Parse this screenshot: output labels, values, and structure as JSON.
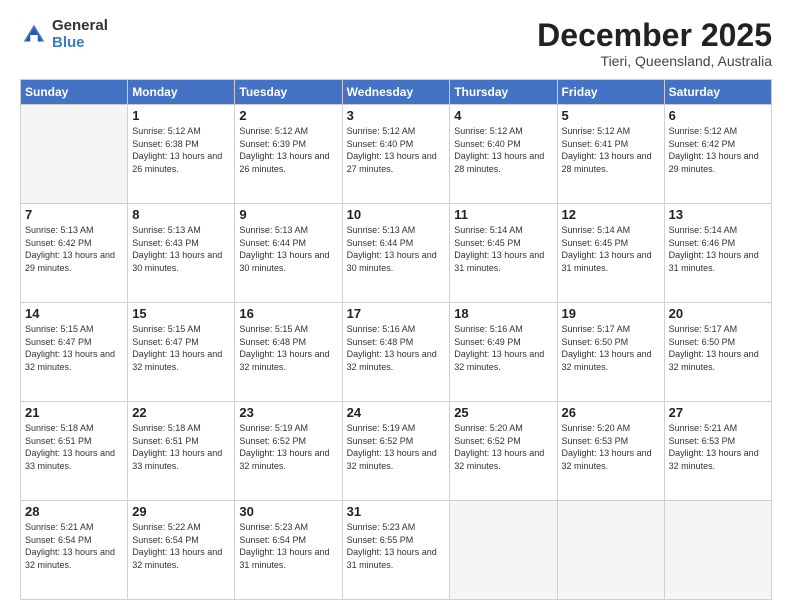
{
  "logo": {
    "general": "General",
    "blue": "Blue"
  },
  "header": {
    "month": "December 2025",
    "location": "Tieri, Queensland, Australia"
  },
  "weekdays": [
    "Sunday",
    "Monday",
    "Tuesday",
    "Wednesday",
    "Thursday",
    "Friday",
    "Saturday"
  ],
  "weeks": [
    [
      {
        "day": "",
        "empty": true
      },
      {
        "day": "1",
        "sunrise": "5:12 AM",
        "sunset": "6:38 PM",
        "daylight": "13 hours and 26 minutes."
      },
      {
        "day": "2",
        "sunrise": "5:12 AM",
        "sunset": "6:39 PM",
        "daylight": "13 hours and 26 minutes."
      },
      {
        "day": "3",
        "sunrise": "5:12 AM",
        "sunset": "6:40 PM",
        "daylight": "13 hours and 27 minutes."
      },
      {
        "day": "4",
        "sunrise": "5:12 AM",
        "sunset": "6:40 PM",
        "daylight": "13 hours and 28 minutes."
      },
      {
        "day": "5",
        "sunrise": "5:12 AM",
        "sunset": "6:41 PM",
        "daylight": "13 hours and 28 minutes."
      },
      {
        "day": "6",
        "sunrise": "5:12 AM",
        "sunset": "6:42 PM",
        "daylight": "13 hours and 29 minutes."
      }
    ],
    [
      {
        "day": "7",
        "sunrise": "5:13 AM",
        "sunset": "6:42 PM",
        "daylight": "13 hours and 29 minutes."
      },
      {
        "day": "8",
        "sunrise": "5:13 AM",
        "sunset": "6:43 PM",
        "daylight": "13 hours and 30 minutes."
      },
      {
        "day": "9",
        "sunrise": "5:13 AM",
        "sunset": "6:44 PM",
        "daylight": "13 hours and 30 minutes."
      },
      {
        "day": "10",
        "sunrise": "5:13 AM",
        "sunset": "6:44 PM",
        "daylight": "13 hours and 30 minutes."
      },
      {
        "day": "11",
        "sunrise": "5:14 AM",
        "sunset": "6:45 PM",
        "daylight": "13 hours and 31 minutes."
      },
      {
        "day": "12",
        "sunrise": "5:14 AM",
        "sunset": "6:45 PM",
        "daylight": "13 hours and 31 minutes."
      },
      {
        "day": "13",
        "sunrise": "5:14 AM",
        "sunset": "6:46 PM",
        "daylight": "13 hours and 31 minutes."
      }
    ],
    [
      {
        "day": "14",
        "sunrise": "5:15 AM",
        "sunset": "6:47 PM",
        "daylight": "13 hours and 32 minutes."
      },
      {
        "day": "15",
        "sunrise": "5:15 AM",
        "sunset": "6:47 PM",
        "daylight": "13 hours and 32 minutes."
      },
      {
        "day": "16",
        "sunrise": "5:15 AM",
        "sunset": "6:48 PM",
        "daylight": "13 hours and 32 minutes."
      },
      {
        "day": "17",
        "sunrise": "5:16 AM",
        "sunset": "6:48 PM",
        "daylight": "13 hours and 32 minutes."
      },
      {
        "day": "18",
        "sunrise": "5:16 AM",
        "sunset": "6:49 PM",
        "daylight": "13 hours and 32 minutes."
      },
      {
        "day": "19",
        "sunrise": "5:17 AM",
        "sunset": "6:50 PM",
        "daylight": "13 hours and 32 minutes."
      },
      {
        "day": "20",
        "sunrise": "5:17 AM",
        "sunset": "6:50 PM",
        "daylight": "13 hours and 32 minutes."
      }
    ],
    [
      {
        "day": "21",
        "sunrise": "5:18 AM",
        "sunset": "6:51 PM",
        "daylight": "13 hours and 33 minutes."
      },
      {
        "day": "22",
        "sunrise": "5:18 AM",
        "sunset": "6:51 PM",
        "daylight": "13 hours and 33 minutes."
      },
      {
        "day": "23",
        "sunrise": "5:19 AM",
        "sunset": "6:52 PM",
        "daylight": "13 hours and 32 minutes."
      },
      {
        "day": "24",
        "sunrise": "5:19 AM",
        "sunset": "6:52 PM",
        "daylight": "13 hours and 32 minutes."
      },
      {
        "day": "25",
        "sunrise": "5:20 AM",
        "sunset": "6:52 PM",
        "daylight": "13 hours and 32 minutes."
      },
      {
        "day": "26",
        "sunrise": "5:20 AM",
        "sunset": "6:53 PM",
        "daylight": "13 hours and 32 minutes."
      },
      {
        "day": "27",
        "sunrise": "5:21 AM",
        "sunset": "6:53 PM",
        "daylight": "13 hours and 32 minutes."
      }
    ],
    [
      {
        "day": "28",
        "sunrise": "5:21 AM",
        "sunset": "6:54 PM",
        "daylight": "13 hours and 32 minutes."
      },
      {
        "day": "29",
        "sunrise": "5:22 AM",
        "sunset": "6:54 PM",
        "daylight": "13 hours and 32 minutes."
      },
      {
        "day": "30",
        "sunrise": "5:23 AM",
        "sunset": "6:54 PM",
        "daylight": "13 hours and 31 minutes."
      },
      {
        "day": "31",
        "sunrise": "5:23 AM",
        "sunset": "6:55 PM",
        "daylight": "13 hours and 31 minutes."
      },
      {
        "day": "",
        "empty": true
      },
      {
        "day": "",
        "empty": true
      },
      {
        "day": "",
        "empty": true
      }
    ]
  ]
}
